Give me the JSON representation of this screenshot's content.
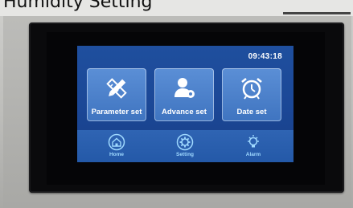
{
  "header": {
    "caption": "Humidity Setting",
    "caption_visible": "Humidity Setting"
  },
  "status": {
    "time": "09:43:18"
  },
  "tiles": [
    {
      "label": "Parameter set",
      "icon": "pencil-ruler-icon"
    },
    {
      "label": "Advance set",
      "icon": "user-gear-icon"
    },
    {
      "label": "Date set",
      "icon": "alarm-clock-icon"
    }
  ],
  "nav": [
    {
      "label": "Home",
      "icon": "home-icon"
    },
    {
      "label": "Setting",
      "icon": "gear-icon"
    },
    {
      "label": "Alarm",
      "icon": "lightbulb-icon"
    }
  ],
  "colors": {
    "screen_bg": "#1f4f9e",
    "tile_bg": "#4d82cc",
    "navbar_bg": "#2a5fae",
    "nav_accent": "#9fd9ff"
  }
}
